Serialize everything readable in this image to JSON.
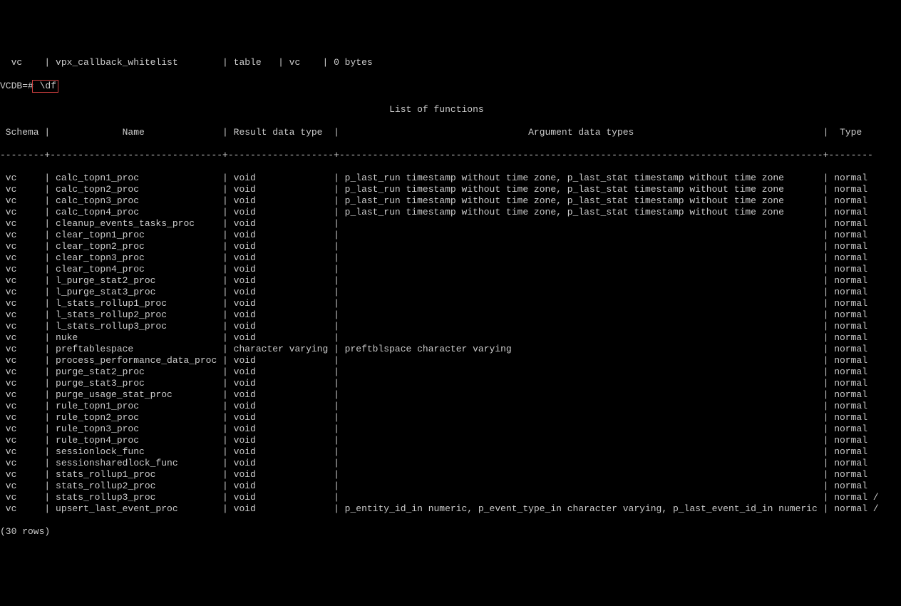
{
  "top_row": {
    "schema": " vc",
    "name": "vpx_callback_whitelist",
    "kind": "table",
    "owner": "vc",
    "size": "0 bytes"
  },
  "prompt_prefix": "VCDB=#",
  "prompt_command": " \\df",
  "title": "List of functions",
  "headers": {
    "schema": "Schema",
    "name": "Name",
    "result": "Result data type",
    "args": "Argument data types",
    "type": "Type"
  },
  "divider": "--------+-------------------------------+-------------------+---------------------------------------------------------------------------------------+--------",
  "rows": [
    {
      "schema": "vc",
      "name": "calc_topn1_proc",
      "result": "void",
      "args": "p_last_run timestamp without time zone, p_last_stat timestamp without time zone",
      "type": "normal"
    },
    {
      "schema": "vc",
      "name": "calc_topn2_proc",
      "result": "void",
      "args": "p_last_run timestamp without time zone, p_last_stat timestamp without time zone",
      "type": "normal"
    },
    {
      "schema": "vc",
      "name": "calc_topn3_proc",
      "result": "void",
      "args": "p_last_run timestamp without time zone, p_last_stat timestamp without time zone",
      "type": "normal"
    },
    {
      "schema": "vc",
      "name": "calc_topn4_proc",
      "result": "void",
      "args": "p_last_run timestamp without time zone, p_last_stat timestamp without time zone",
      "type": "normal"
    },
    {
      "schema": "vc",
      "name": "cleanup_events_tasks_proc",
      "result": "void",
      "args": "",
      "type": "normal"
    },
    {
      "schema": "vc",
      "name": "clear_topn1_proc",
      "result": "void",
      "args": "",
      "type": "normal"
    },
    {
      "schema": "vc",
      "name": "clear_topn2_proc",
      "result": "void",
      "args": "",
      "type": "normal"
    },
    {
      "schema": "vc",
      "name": "clear_topn3_proc",
      "result": "void",
      "args": "",
      "type": "normal"
    },
    {
      "schema": "vc",
      "name": "clear_topn4_proc",
      "result": "void",
      "args": "",
      "type": "normal"
    },
    {
      "schema": "vc",
      "name": "l_purge_stat2_proc",
      "result": "void",
      "args": "",
      "type": "normal"
    },
    {
      "schema": "vc",
      "name": "l_purge_stat3_proc",
      "result": "void",
      "args": "",
      "type": "normal"
    },
    {
      "schema": "vc",
      "name": "l_stats_rollup1_proc",
      "result": "void",
      "args": "",
      "type": "normal"
    },
    {
      "schema": "vc",
      "name": "l_stats_rollup2_proc",
      "result": "void",
      "args": "",
      "type": "normal"
    },
    {
      "schema": "vc",
      "name": "l_stats_rollup3_proc",
      "result": "void",
      "args": "",
      "type": "normal"
    },
    {
      "schema": "vc",
      "name": "nuke",
      "result": "void",
      "args": "",
      "type": "normal"
    },
    {
      "schema": "vc",
      "name": "preftablespace",
      "result": "character varying",
      "args": "preftblspace character varying",
      "type": "normal"
    },
    {
      "schema": "vc",
      "name": "process_performance_data_proc",
      "result": "void",
      "args": "",
      "type": "normal"
    },
    {
      "schema": "vc",
      "name": "purge_stat2_proc",
      "result": "void",
      "args": "",
      "type": "normal"
    },
    {
      "schema": "vc",
      "name": "purge_stat3_proc",
      "result": "void",
      "args": "",
      "type": "normal"
    },
    {
      "schema": "vc",
      "name": "purge_usage_stat_proc",
      "result": "void",
      "args": "",
      "type": "normal"
    },
    {
      "schema": "vc",
      "name": "rule_topn1_proc",
      "result": "void",
      "args": "",
      "type": "normal"
    },
    {
      "schema": "vc",
      "name": "rule_topn2_proc",
      "result": "void",
      "args": "",
      "type": "normal"
    },
    {
      "schema": "vc",
      "name": "rule_topn3_proc",
      "result": "void",
      "args": "",
      "type": "normal"
    },
    {
      "schema": "vc",
      "name": "rule_topn4_proc",
      "result": "void",
      "args": "",
      "type": "normal"
    },
    {
      "schema": "vc",
      "name": "sessionlock_func",
      "result": "void",
      "args": "",
      "type": "normal"
    },
    {
      "schema": "vc",
      "name": "sessionsharedlock_func",
      "result": "void",
      "args": "",
      "type": "normal"
    },
    {
      "schema": "vc",
      "name": "stats_rollup1_proc",
      "result": "void",
      "args": "",
      "type": "normal"
    },
    {
      "schema": "vc",
      "name": "stats_rollup2_proc",
      "result": "void",
      "args": "",
      "type": "normal"
    },
    {
      "schema": "vc",
      "name": "stats_rollup3_proc",
      "result": "void",
      "args": "",
      "type": "normal /"
    },
    {
      "schema": "vc",
      "name": "upsert_last_event_proc",
      "result": "void",
      "args": "p_entity_id_in numeric, p_event_type_in character varying, p_last_event_id_in numeric",
      "type": "normal /"
    }
  ],
  "footer": "(30 rows)",
  "col_widths": {
    "schema": 8,
    "name": 31,
    "result": 19,
    "args": 87,
    "type": 8
  }
}
